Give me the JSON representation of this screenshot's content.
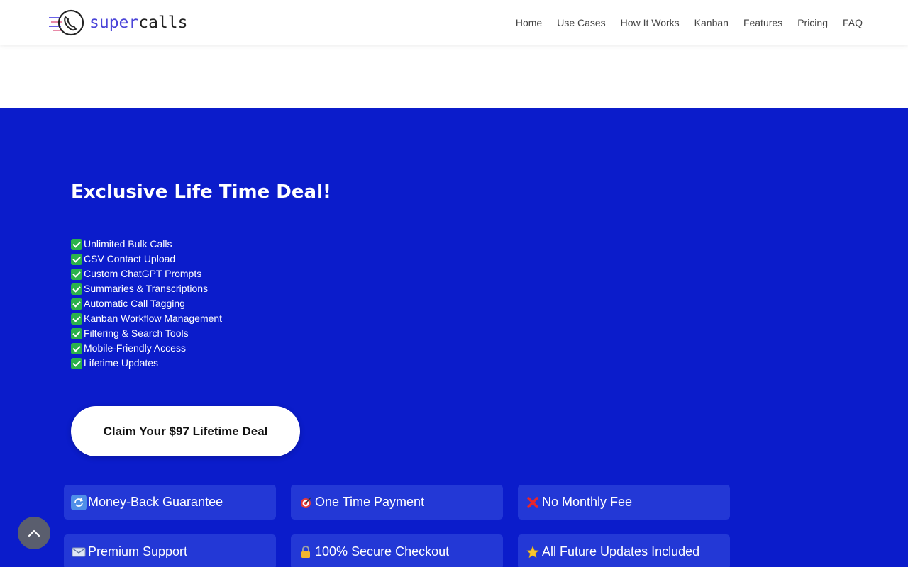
{
  "brand": {
    "part1": "super",
    "part2": "calls"
  },
  "nav": [
    "Home",
    "Use Cases",
    "How It Works",
    "Kanban",
    "Features",
    "Pricing",
    "FAQ"
  ],
  "hero": {
    "headline": "Exclusive Life Time Deal!",
    "features": [
      "Unlimited Bulk Calls",
      "CSV Contact Upload",
      "Custom ChatGPT Prompts",
      "Summaries & Transcriptions",
      "Automatic Call Tagging",
      "Kanban Workflow Management",
      "Filtering & Search Tools",
      "Mobile-Friendly Access",
      "Lifetime Updates"
    ],
    "cta": "Claim Your $97 Lifetime Deal"
  },
  "badges": [
    {
      "icon": "refresh-icon",
      "label": "Money-Back Guarantee"
    },
    {
      "icon": "target-icon",
      "label": "One Time Payment"
    },
    {
      "icon": "cross-mark-icon",
      "label": "No Monthly Fee"
    },
    {
      "icon": "mail-icon",
      "label": "Premium Support"
    },
    {
      "icon": "lock-icon",
      "label": "100% Secure Checkout"
    },
    {
      "icon": "star-icon",
      "label": "All Future Updates Included"
    }
  ],
  "colors": {
    "hero_bg": "#0b1ccb",
    "badge_bg": "#2338d6",
    "brand_accent": "#4b45d8",
    "check_green": "#2bb24c"
  }
}
